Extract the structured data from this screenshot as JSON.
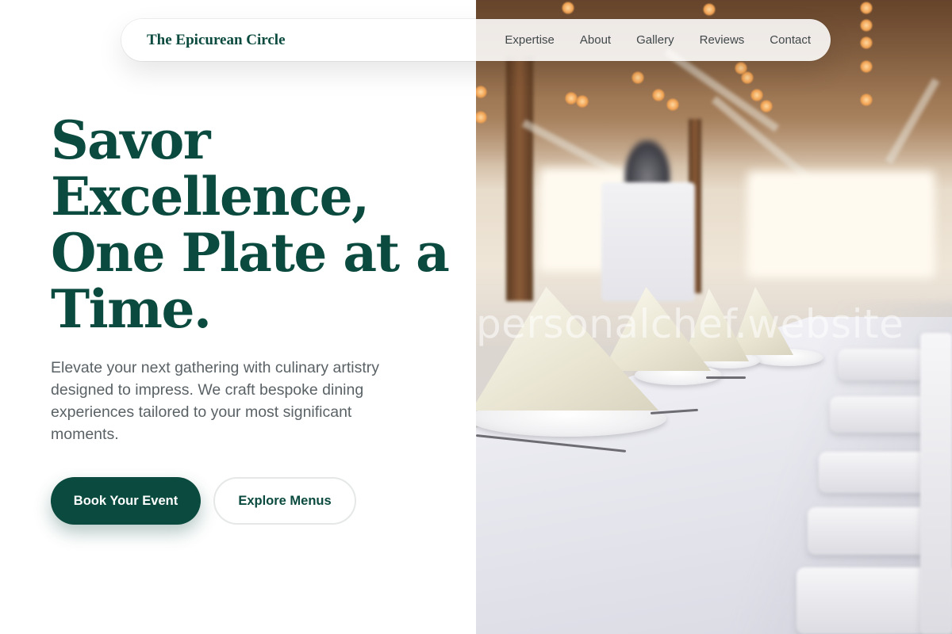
{
  "brand": {
    "name": "The Epicurean Circle"
  },
  "nav": {
    "items": [
      {
        "label": "Expertise"
      },
      {
        "label": "About"
      },
      {
        "label": "Gallery"
      },
      {
        "label": "Reviews"
      },
      {
        "label": "Contact"
      }
    ]
  },
  "hero": {
    "title": "Savor Excellence, One Plate at a Time.",
    "subtitle": "Elevate your next gathering with culinary artistry designed to impress. We craft bespoke dining experiences tailored to your most significant moments.",
    "primary_button": "Book Your Event",
    "secondary_button": "Explore Menus"
  },
  "image": {
    "watermark": "personalchef.website",
    "subject": "banquet-table-photo"
  },
  "colors": {
    "brand_green": "#0b4a3e",
    "body_text": "#5a6266",
    "nav_text": "#40484a",
    "background": "#ffffff"
  }
}
